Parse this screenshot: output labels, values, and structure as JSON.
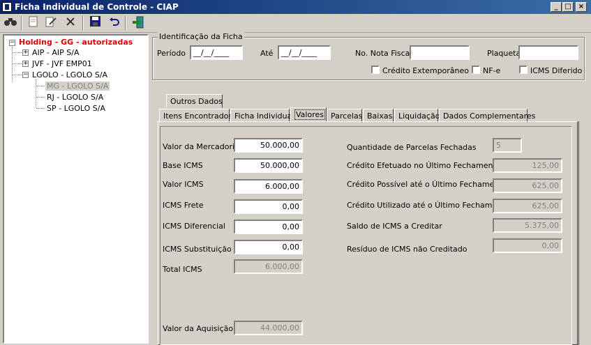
{
  "window": {
    "title": "Ficha Individual de Controle - CIAP"
  },
  "window_controls": {
    "minimize": "_",
    "maximize": "□",
    "close": "×"
  },
  "toolbar": {
    "icons": [
      "binoculars-icon",
      "new-doc-icon",
      "edit-icon",
      "delete-icon",
      "save-icon",
      "undo-icon",
      "exit-icon"
    ]
  },
  "tree": {
    "root": "Holding - GG - autorizadas",
    "items": [
      {
        "label": "AIP - AIP S/A",
        "expander": "+"
      },
      {
        "label": "JVF - JVF  EMP01",
        "expander": "+"
      },
      {
        "label": "LGOLO - LGOLO S/A",
        "expander": "−"
      }
    ],
    "children": [
      {
        "label": "MG - LGOLO S/A"
      },
      {
        "label": "RJ - LGOLO S/A"
      },
      {
        "label": "SP - LGOLO S/A"
      }
    ]
  },
  "identificacao": {
    "legend": "Identificação da Ficha",
    "periodo_label": "Período",
    "periodo_value": "__/__/____",
    "ate_label": "Até",
    "ate_value": "__/__/____",
    "nota_label": "No. Nota Fiscal",
    "nota_value": "",
    "plaqueta_label": "Plaqueta",
    "plaqueta_value": "",
    "credito_ext_label": "Crédito Extemporâneo",
    "nfe_label": "NF-e",
    "icms_diferido_label": "ICMS Diferido"
  },
  "tabs": {
    "top": [
      "Outros Dados"
    ],
    "bottom": [
      "Itens Encontrados",
      "Ficha Individual",
      "Valores",
      "Parcelas",
      "Baixas",
      "Liquidação",
      "Dados Complementares"
    ],
    "active": "Valores"
  },
  "valores": {
    "left": [
      {
        "label": "Valor da Mercadoria",
        "value": "50.000,00",
        "readonly": false
      },
      {
        "label": "Base ICMS",
        "value": "50.000,00",
        "readonly": false
      },
      {
        "label": "Valor ICMS",
        "value": "6.000,00",
        "readonly": false
      },
      {
        "label": "ICMS Frete",
        "value": "0,00",
        "readonly": false
      },
      {
        "label": "ICMS Diferencial",
        "value": "0,00",
        "readonly": false
      },
      {
        "label": "ICMS Substituição",
        "value": "0,00",
        "readonly": false
      },
      {
        "label": "Total ICMS",
        "value": "6.000,00",
        "readonly": true
      }
    ],
    "aquisicao_label": "Valor da Aquisição",
    "aquisicao_value": "44.000,00",
    "right": [
      {
        "label": "Quantidade de Parcelas Fechadas",
        "value": "5"
      },
      {
        "label": "Crédito Efetuado no Último Fechamento",
        "value": "125,00"
      },
      {
        "label": "Crédito Possível até o Último Fechamento",
        "value": "625,00"
      },
      {
        "label": "Crédito Utilizado até o Último Fechamento",
        "value": "625,00"
      },
      {
        "label": "Saldo de ICMS a Creditar",
        "value": "5.375,00"
      },
      {
        "label": "Resíduo de ICMS não Creditado",
        "value": "0,00"
      }
    ]
  }
}
